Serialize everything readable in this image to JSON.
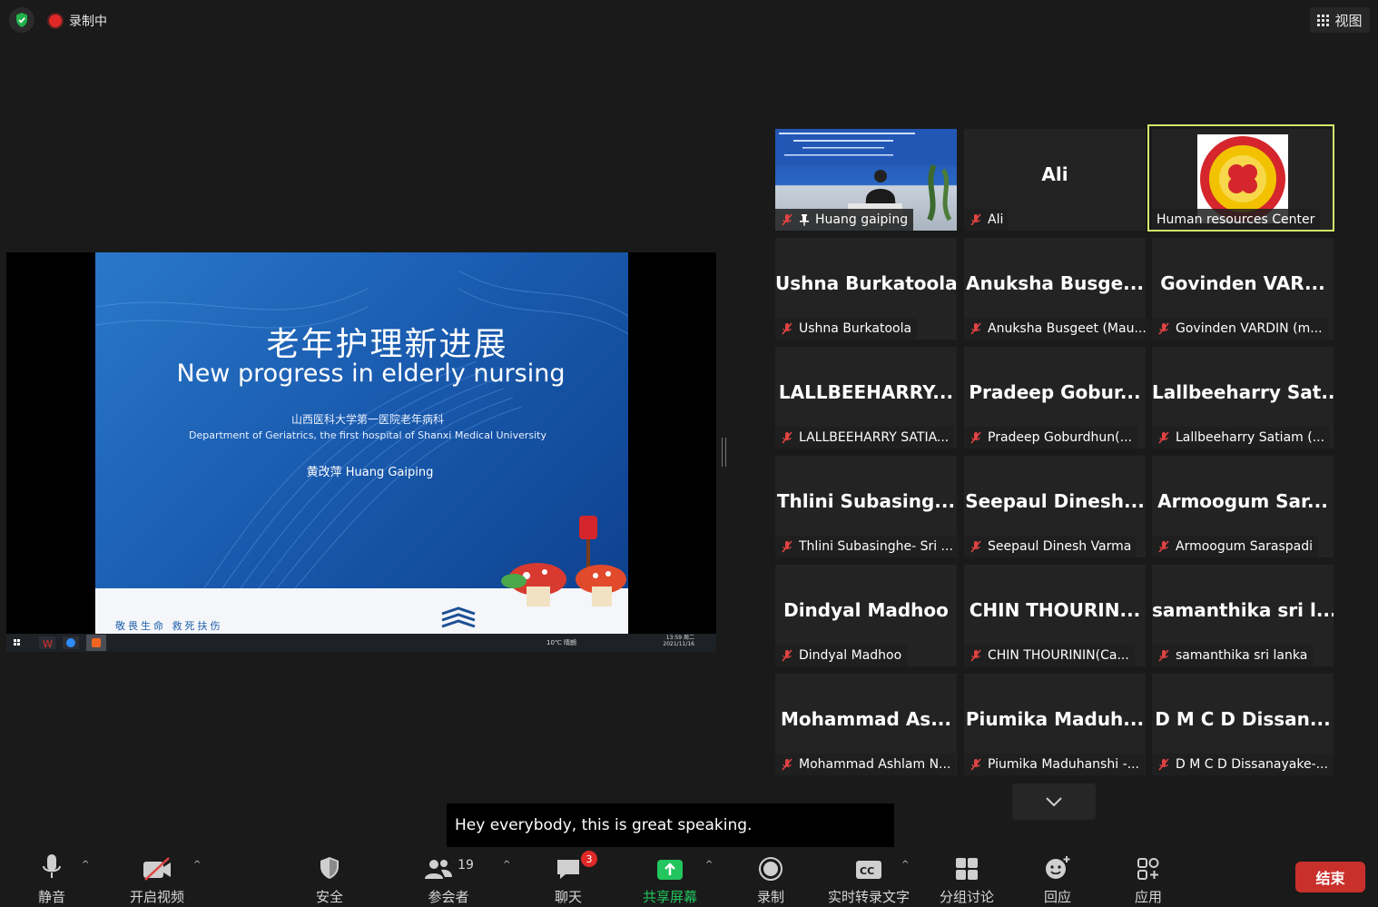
{
  "topbar": {
    "recording_label": "录制中",
    "view_label": "视图"
  },
  "share": {
    "slide": {
      "title_cn": "老年护理新进展",
      "title_en": "New progress in elderly nursing",
      "dept_cn": "山西医科大学第一医院老年病科",
      "dept_en": "Department of Geriatrics, the first hospital of Shanxi Medical University",
      "author": "黄改萍 Huang Gaiping",
      "motto": "敬畏生命 救死扶伤"
    },
    "taskbar": {
      "weather": "10℃ 晴朗",
      "time": "13:59 周二",
      "date": "2021/11/16"
    }
  },
  "gallery": [
    {
      "big": "",
      "label": "Huang gaiping",
      "pinned": true
    },
    {
      "big": "Ali",
      "label": "Ali"
    },
    {
      "big": "",
      "label": "Human resources Center",
      "active": true
    },
    {
      "big": "Ushna Burkatoola",
      "label": "Ushna Burkatoola"
    },
    {
      "big": "Anuksha Busge...",
      "label": "Anuksha Busgeet (Mau..."
    },
    {
      "big": "Govinden VAR...",
      "label": "Govinden VARDIN (m..."
    },
    {
      "big": "LALLBEEHARRY...",
      "label": "LALLBEEHARRY SATIA..."
    },
    {
      "big": "Pradeep Gobur...",
      "label": "Pradeep Goburdhun(..."
    },
    {
      "big": "Lallbeeharry Sat...",
      "label": "Lallbeeharry Satiam (..."
    },
    {
      "big": "Thlini Subasing...",
      "label": "Thlini Subasinghe- Sri ..."
    },
    {
      "big": "Seepaul Dinesh...",
      "label": "Seepaul Dinesh Varma"
    },
    {
      "big": "Armoogum Sar...",
      "label": "Armoogum Saraspadi"
    },
    {
      "big": "Dindyal Madhoo",
      "label": "Dindyal Madhoo"
    },
    {
      "big": "CHIN THOURIN...",
      "label": "CHIN THOURININ(Ca..."
    },
    {
      "big": "samanthika sri l...",
      "label": "samanthika sri lanka"
    },
    {
      "big": "Mohammad As...",
      "label": "Mohammad Ashlam N..."
    },
    {
      "big": "Piumika Maduh...",
      "label": "Piumika Maduhanshi -..."
    },
    {
      "big": "D M C D Dissan...",
      "label": "D M C D Dissanayake-..."
    }
  ],
  "caption": "Hey everybody, this is great speaking.",
  "toolbar": {
    "mute": "静音",
    "video": "开启视频",
    "security": "安全",
    "participants": "参会者",
    "participants_count": "19",
    "chat": "聊天",
    "chat_badge": "3",
    "share": "共享屏幕",
    "record": "录制",
    "transcript": "实时转录文字",
    "breakout": "分组讨论",
    "reactions": "回应",
    "apps": "应用",
    "end": "结束"
  },
  "colors": {
    "active_speaker_border": "#cfe96a",
    "share_green": "#22c55e",
    "end_red": "#c9302c",
    "mic_off_red": "#e04343"
  }
}
